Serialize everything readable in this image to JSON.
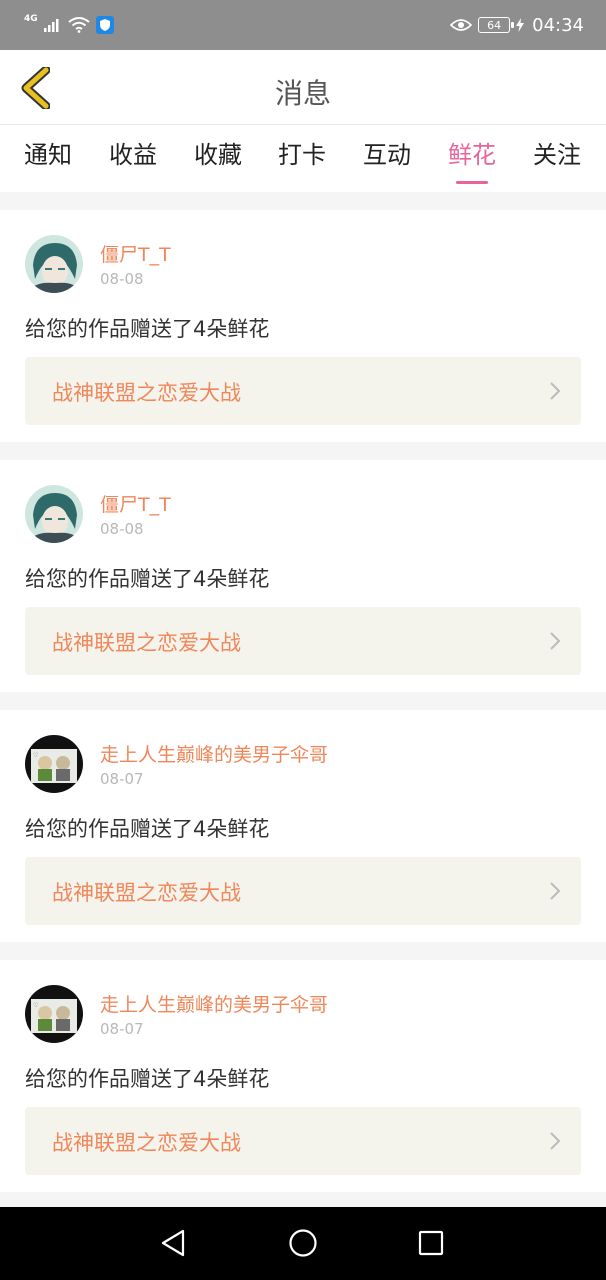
{
  "status_bar": {
    "network": "4G",
    "battery": "64",
    "time": "04:34"
  },
  "header": {
    "title": "消息"
  },
  "tabs": [
    {
      "label": "通知"
    },
    {
      "label": "收益"
    },
    {
      "label": "收藏"
    },
    {
      "label": "打卡"
    },
    {
      "label": "互动"
    },
    {
      "label": "鲜花",
      "active": true
    },
    {
      "label": "关注"
    }
  ],
  "messages": [
    {
      "username": "僵尸T_T",
      "date": "08-08",
      "text": "给您的作品赠送了4朵鲜花",
      "work_title": "战神联盟之恋爱大战"
    },
    {
      "username": "僵尸T_T",
      "date": "08-08",
      "text": "给您的作品赠送了4朵鲜花",
      "work_title": "战神联盟之恋爱大战"
    },
    {
      "username": "走上人生巅峰的美男子伞哥",
      "date": "08-07",
      "text": "给您的作品赠送了4朵鲜花",
      "work_title": "战神联盟之恋爱大战"
    },
    {
      "username": "走上人生巅峰的美男子伞哥",
      "date": "08-07",
      "text": "给您的作品赠送了4朵鲜花",
      "work_title": "战神联盟之恋爱大战"
    }
  ],
  "colors": {
    "accent": "#e8649c",
    "username": "#f0875a",
    "back_arrow": "#e8c020"
  }
}
